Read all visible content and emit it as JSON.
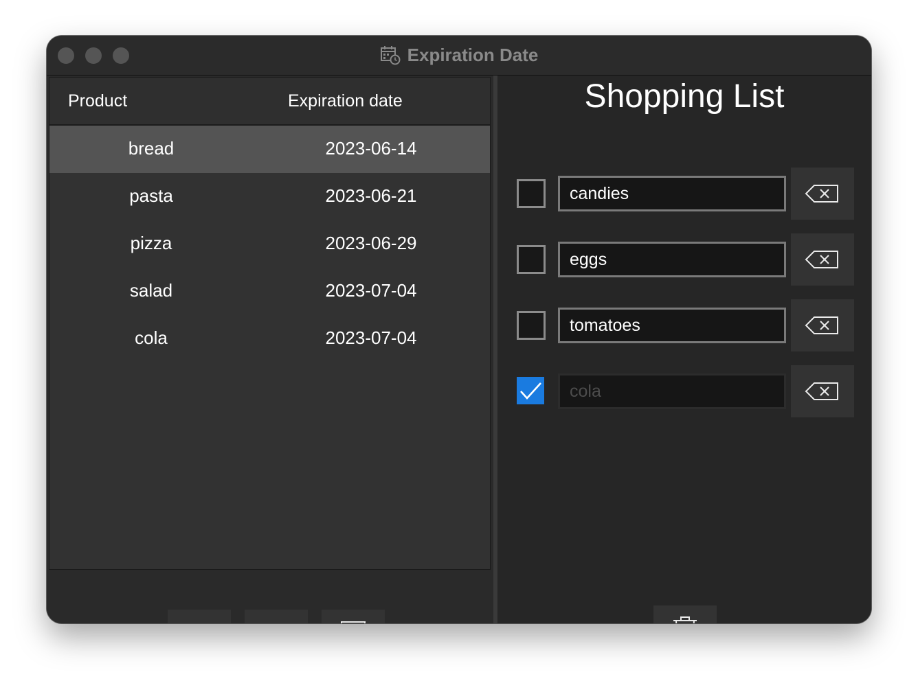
{
  "window": {
    "title": "Expiration Date",
    "app_icon": "calendar-clock-icon"
  },
  "products": {
    "columns": [
      "Product",
      "Expiration date"
    ],
    "rows": [
      {
        "product": "bread",
        "date": "2023-06-14",
        "selected": true
      },
      {
        "product": "pasta",
        "date": "2023-06-21",
        "selected": false
      },
      {
        "product": "pizza",
        "date": "2023-06-29",
        "selected": false
      },
      {
        "product": "salad",
        "date": "2023-07-04",
        "selected": false
      },
      {
        "product": "cola",
        "date": "2023-07-04",
        "selected": false
      }
    ],
    "toolbar_icons": [
      "plus-icon",
      "close-icon",
      "recipe-book-icon"
    ]
  },
  "shopping": {
    "title": "Shopping List",
    "items": [
      {
        "text": "candies",
        "checked": false
      },
      {
        "text": "eggs",
        "checked": false
      },
      {
        "text": "tomatoes",
        "checked": false
      },
      {
        "text": "cola",
        "checked": true
      }
    ],
    "delete_icon": "backspace-icon",
    "clear_icon": "trash-icon"
  },
  "colors": {
    "accent": "#1a7be0",
    "window_bg": "#262626",
    "selected_row": "#545454"
  }
}
